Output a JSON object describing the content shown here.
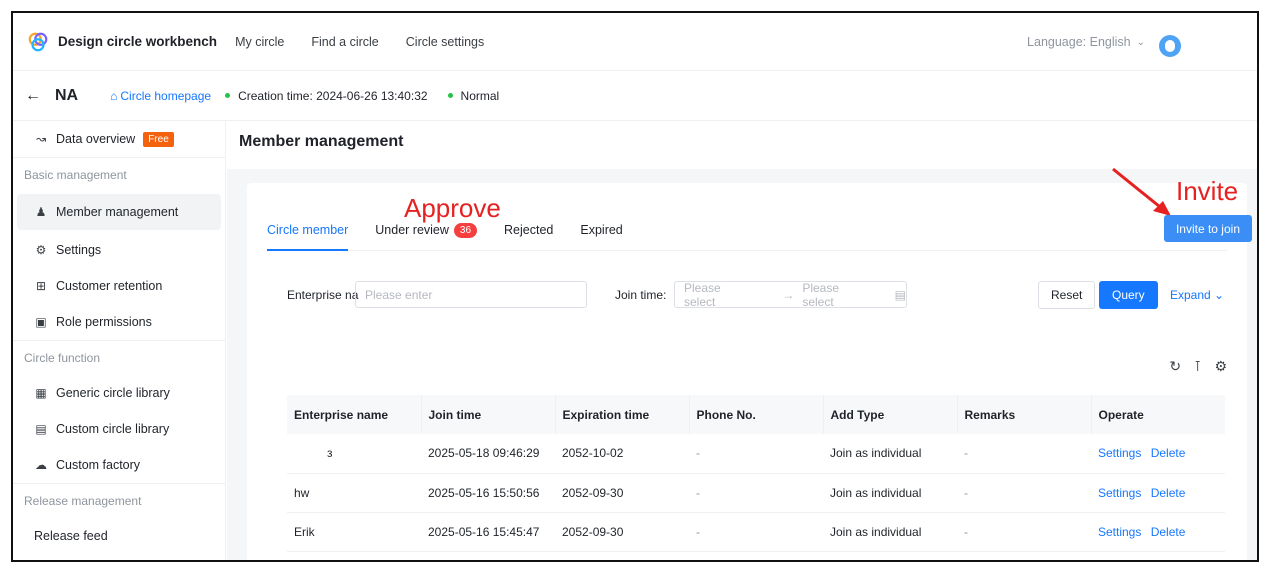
{
  "topnav": {
    "brand": "Design circle workbench",
    "links": [
      "My circle",
      "Find a circle",
      "Circle settings"
    ],
    "language_label": "Language: English"
  },
  "subhead": {
    "circle_name": "NA",
    "home_link": "Circle homepage",
    "creation_time": "Creation time: 2024-06-26 13:40:32",
    "status": "Normal"
  },
  "sidebar": {
    "data_overview": "Data overview",
    "free_badge": "Free",
    "basic_group": "Basic management",
    "member_mgmt": "Member management",
    "settings": "Settings",
    "customer_retention": "Customer retention",
    "role_permissions": "Role permissions",
    "circle_group": "Circle function",
    "generic_library": "Generic circle library",
    "custom_library": "Custom circle library",
    "custom_factory": "Custom factory",
    "release_group": "Release management",
    "release_feed": "Release feed"
  },
  "main": {
    "title": "Member management",
    "tabs": {
      "member": "Circle member",
      "review": "Under review",
      "review_count": "36",
      "rejected": "Rejected",
      "expired": "Expired"
    },
    "invite_button": "Invite to join",
    "annotations": {
      "approve": "Approve",
      "invite": "Invite"
    },
    "filters": {
      "enterprise_label": "Enterprise na",
      "enterprise_placeholder": "Please enter",
      "join_time_label": "Join time:",
      "start_placeholder": "Please select",
      "end_placeholder": "Please select",
      "reset": "Reset",
      "query": "Query",
      "expand": "Expand"
    },
    "table": {
      "headers": {
        "enterprise": "Enterprise name",
        "join_time": "Join time",
        "expiration": "Expiration time",
        "phone": "Phone No.",
        "add_type": "Add Type",
        "remarks": "Remarks",
        "operate": "Operate"
      },
      "rows": [
        {
          "enterprise": "з",
          "join_time": "2025-05-18 09:46:29",
          "expiration": "2052-10-02",
          "phone": "-",
          "add_type": "Join as individual",
          "remarks": "-",
          "op_settings": "Settings",
          "op_delete": "Delete"
        },
        {
          "enterprise": "hw",
          "join_time": "2025-05-16 15:50:56",
          "expiration": "2052-09-30",
          "phone": "-",
          "add_type": "Join as individual",
          "remarks": "-",
          "op_settings": "Settings",
          "op_delete": "Delete"
        },
        {
          "enterprise": "Erik",
          "join_time": "2025-05-16 15:45:47",
          "expiration": "2052-09-30",
          "phone": "-",
          "add_type": "Join as individual",
          "remarks": "-",
          "op_settings": "Settings",
          "op_delete": "Delete"
        }
      ]
    }
  },
  "colors": {
    "accent": "#1677ff",
    "badge_red": "#f53f3f",
    "free_orange": "#f5620e",
    "annotation_red": "#e62121"
  }
}
